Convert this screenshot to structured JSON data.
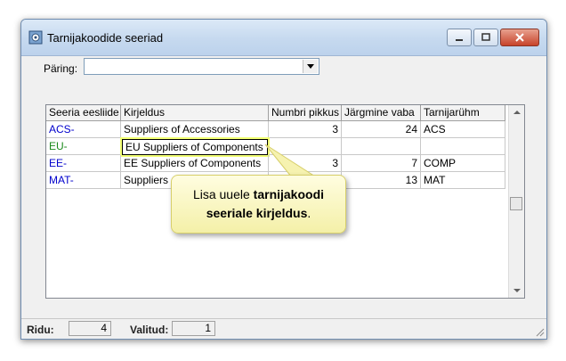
{
  "window": {
    "title": "Tarnijakoodide seeriad"
  },
  "query": {
    "label": "Päring:",
    "value": ""
  },
  "grid": {
    "columns": [
      "Seeria eesliide",
      "Kirjeldus",
      "Numbri pikkus",
      "Järgmine vaba",
      "Tarnijarühm"
    ],
    "rows": [
      {
        "prefix": "ACS-",
        "description": "Suppliers of Accessories",
        "length": "3",
        "next": "24",
        "group": "ACS"
      },
      {
        "prefix": "EU-",
        "description": "EU Suppliers of Components",
        "length": "",
        "next": "",
        "group": ""
      },
      {
        "prefix": "EE-",
        "description": "EE Suppliers of Components",
        "length": "3",
        "next": "7",
        "group": "COMP"
      },
      {
        "prefix": "MAT-",
        "description": "Suppliers o",
        "length": "",
        "next": "13",
        "group": "MAT"
      }
    ]
  },
  "status": {
    "rows_label": "Ridu:",
    "rows_value": "4",
    "selected_label": "Valitud:",
    "selected_value": "1"
  },
  "callout": {
    "line1_plain": "Lisa uuele ",
    "line1_bold": "tarnijakoodi",
    "line2_bold": "seeriale kirjeldus",
    "line2_end": "."
  },
  "colors": {
    "prefix_blue": "#0000cc",
    "prefix_new": "#1c8a1c",
    "callout_bg": "#f8f4b8",
    "highlight": "#f2ff73"
  }
}
